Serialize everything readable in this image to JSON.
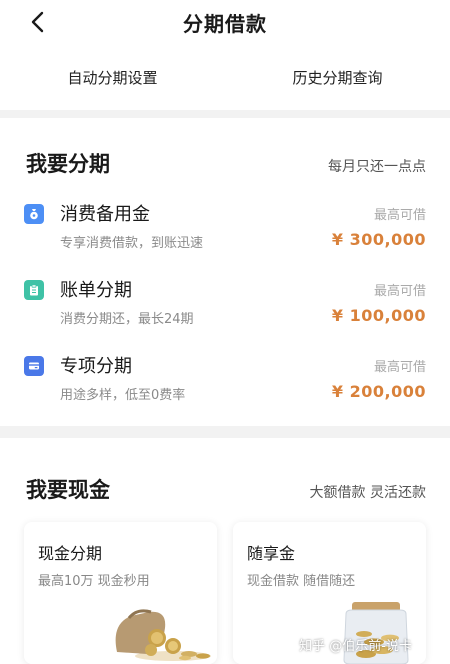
{
  "header": {
    "title": "分期借款",
    "back_icon": "chevron-left-icon"
  },
  "quick_links": [
    {
      "label": "自动分期设置"
    },
    {
      "label": "历史分期查询"
    }
  ],
  "installment": {
    "title": "我要分期",
    "subtitle": "每月只还一点点",
    "items": [
      {
        "name": "消费备用金",
        "desc": "专享消费借款，到账迅速",
        "hint": "最高可借",
        "amount": "¥ 300,000",
        "icon": "moneybag-icon",
        "color": "#4d8ff5"
      },
      {
        "name": "账单分期",
        "desc": "消费分期还，最长24期",
        "hint": "最高可借",
        "amount": "¥ 100,000",
        "icon": "clipboard-icon",
        "color": "#3fc2a6"
      },
      {
        "name": "专项分期",
        "desc": "用途多样，低至0费率",
        "hint": "最高可借",
        "amount": "¥ 200,000",
        "icon": "card-icon",
        "color": "#4a78e8"
      }
    ]
  },
  "cash": {
    "title": "我要现金",
    "subtitle": "大额借款 灵活还款",
    "tiles": [
      {
        "title": "现金分期",
        "desc": "最高10万 现金秒用"
      },
      {
        "title": "随享金",
        "desc": "现金借款 随借随还"
      }
    ]
  },
  "watermark": "知乎 @伯乐前-说卡",
  "colors": {
    "accent_amount": "#d9813a",
    "background": "#f2f2f2"
  }
}
